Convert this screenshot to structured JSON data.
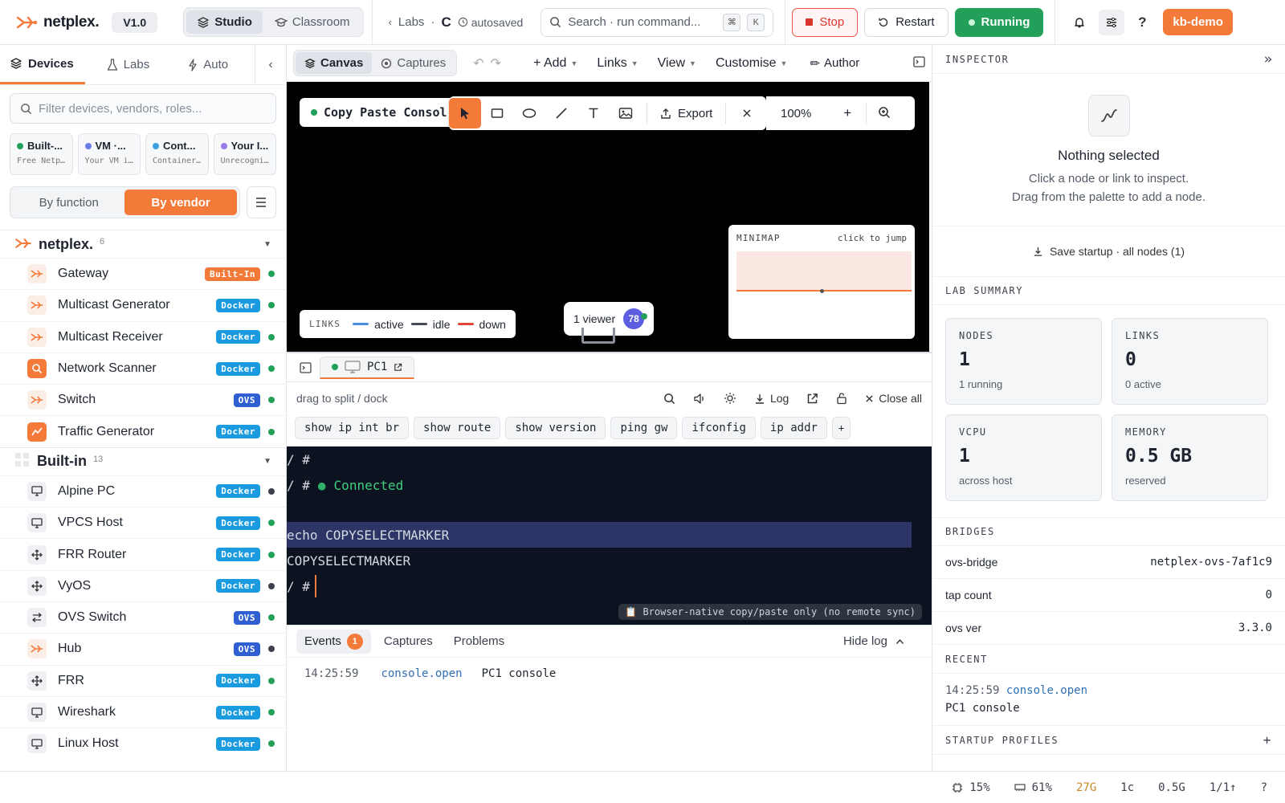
{
  "header": {
    "brand": "netplex.",
    "version": "V1.0",
    "modes": [
      "Studio",
      "Classroom"
    ],
    "breadcrumb_labs": "Labs",
    "breadcrumb_sep": "·",
    "breadcrumb_lab": "C",
    "autosave": "autosaved",
    "search_placeholder": "Search · run command...",
    "kbd_1": "⌘",
    "kbd_2": "K",
    "stop": "Stop",
    "restart": "Restart",
    "running": "Running",
    "help": "?",
    "user": "kb-demo",
    "accent": "#f47a3a"
  },
  "sidebar": {
    "tabs": [
      "Devices",
      "Labs",
      "Auto"
    ],
    "filter_placeholder": "Filter devices, vendors, roles...",
    "cards": [
      {
        "title": "Built-...",
        "sub": "Free Netp…",
        "color": "#22a05a"
      },
      {
        "title": "VM ·...",
        "sub": "Your VM i…",
        "color": "#6a7ae8"
      },
      {
        "title": "Cont...",
        "sub": "Container…",
        "color": "#3aa0e0"
      },
      {
        "title": "Your I...",
        "sub": "Unrecogni…",
        "color": "#9a7ae8"
      }
    ],
    "group_by": [
      "By function",
      "By vendor"
    ],
    "groups": [
      {
        "name": "netplex.",
        "count": "6",
        "items": [
          {
            "name": "Gateway",
            "badge": "Built-In",
            "badge_color": "#f47a3a",
            "status": "#22a05a",
            "icon": "netplex-icon"
          },
          {
            "name": "Multicast Generator",
            "badge": "Docker",
            "badge_color": "#1a9be0",
            "status": "#22a05a",
            "icon": "netplex-icon"
          },
          {
            "name": "Multicast Receiver",
            "badge": "Docker",
            "badge_color": "#1a9be0",
            "status": "#22a05a",
            "icon": "netplex-icon"
          },
          {
            "name": "Network Scanner",
            "badge": "Docker",
            "badge_color": "#1a9be0",
            "status": "#22a05a",
            "icon": "scanner-icon"
          },
          {
            "name": "Switch",
            "badge": "OVS",
            "badge_color": "#2f5fd0",
            "status": "#22a05a",
            "icon": "netplex-icon"
          },
          {
            "name": "Traffic Generator",
            "badge": "Docker",
            "badge_color": "#1a9be0",
            "status": "#22a05a",
            "icon": "traffic-icon"
          }
        ]
      },
      {
        "name": "Built-in",
        "count": "13",
        "items": [
          {
            "name": "Alpine PC",
            "badge": "Docker",
            "badge_color": "#1a9be0",
            "status": "#3b404c",
            "icon": "monitor-icon"
          },
          {
            "name": "VPCS Host",
            "badge": "Docker",
            "badge_color": "#1a9be0",
            "status": "#22a05a",
            "icon": "monitor-icon"
          },
          {
            "name": "FRR Router",
            "badge": "Docker",
            "badge_color": "#1a9be0",
            "status": "#22a05a",
            "icon": "router-icon"
          },
          {
            "name": "VyOS",
            "badge": "Docker",
            "badge_color": "#1a9be0",
            "status": "#3b404c",
            "icon": "router-icon"
          },
          {
            "name": "OVS Switch",
            "badge": "OVS",
            "badge_color": "#2f5fd0",
            "status": "#22a05a",
            "icon": "switch-icon"
          },
          {
            "name": "Hub",
            "badge": "OVS",
            "badge_color": "#2f5fd0",
            "status": "#3b404c",
            "icon": "netplex-icon"
          },
          {
            "name": "FRR",
            "badge": "Docker",
            "badge_color": "#1a9be0",
            "status": "#22a05a",
            "icon": "router-icon"
          },
          {
            "name": "Wireshark",
            "badge": "Docker",
            "badge_color": "#1a9be0",
            "status": "#22a05a",
            "icon": "monitor-icon"
          },
          {
            "name": "Linux Host",
            "badge": "Docker",
            "badge_color": "#1a9be0",
            "status": "#22a05a",
            "icon": "monitor-icon"
          }
        ]
      }
    ]
  },
  "canvas_toolbar": {
    "tabs": [
      "Canvas",
      "Captures"
    ],
    "menus": [
      "+ Add",
      "Links",
      "View",
      "Customise"
    ],
    "author": "Author"
  },
  "canvas": {
    "lab_title": "Copy Paste Consol",
    "export": "Export",
    "zoom": "100%",
    "zoom_plus": "+",
    "legend_title": "LINKS",
    "legend": [
      {
        "label": "active",
        "color": "#4a8de0"
      },
      {
        "label": "idle",
        "color": "#444a55"
      },
      {
        "label": "down",
        "color": "#e0443a"
      }
    ],
    "viewers": "1 viewer",
    "viewer_badge": "78",
    "minimap_title": "MINIMAP",
    "minimap_hint": "click to jump"
  },
  "console": {
    "tab": "PC1",
    "hint": "drag to split / dock",
    "log": "Log",
    "close_all": "Close all",
    "snippets": [
      "show ip int br",
      "show route",
      "show version",
      "ping gw",
      "ifconfig",
      "ip addr"
    ],
    "add_snippet": "+",
    "prompt": "/ #",
    "connected": "Connected",
    "cmd": "echo COPYSELECTMARKER",
    "out": "COPYSELECTMARKER",
    "note": "Browser-native copy/paste only (no remote sync)"
  },
  "events": {
    "tabs": [
      "Events",
      "Captures",
      "Problems"
    ],
    "count": "1",
    "hide": "Hide log",
    "rows": [
      {
        "time": "14:25:59",
        "event": "console.open",
        "msg": "PC1 console"
      }
    ]
  },
  "inspector": {
    "title": "INSPECTOR",
    "collapse": "»",
    "empty_title": "Nothing selected",
    "empty_l1": "Click a node or link to inspect.",
    "empty_l2": "Drag from the palette to add a node.",
    "save": "Save startup · all nodes (1)",
    "summary_title": "LAB SUMMARY",
    "kpis": [
      {
        "label": "NODES",
        "value": "1",
        "sub": "1 running"
      },
      {
        "label": "LINKS",
        "value": "0",
        "sub": "0 active"
      },
      {
        "label": "VCPU",
        "value": "1",
        "sub": "across host"
      },
      {
        "label": "MEMORY",
        "value": "0.5 GB",
        "sub": "reserved"
      }
    ],
    "bridges_title": "BRIDGES",
    "bridges": [
      {
        "k": "ovs-bridge",
        "v": "netplex-ovs-7af1c9"
      },
      {
        "k": "tap count",
        "v": "0"
      },
      {
        "k": "ovs ver",
        "v": "3.3.0"
      }
    ],
    "recent_title": "RECENT",
    "recent_time": "14:25:59",
    "recent_event": "console.open",
    "recent_msg": "PC1 console",
    "profiles_title": "STARTUP PROFILES",
    "profiles_add": "+"
  },
  "status": {
    "cpu": "15%",
    "mem": "61%",
    "disk": "27G",
    "cores": "1c",
    "ram": "0.5G",
    "nodes": "1/1↑",
    "help": "?"
  }
}
